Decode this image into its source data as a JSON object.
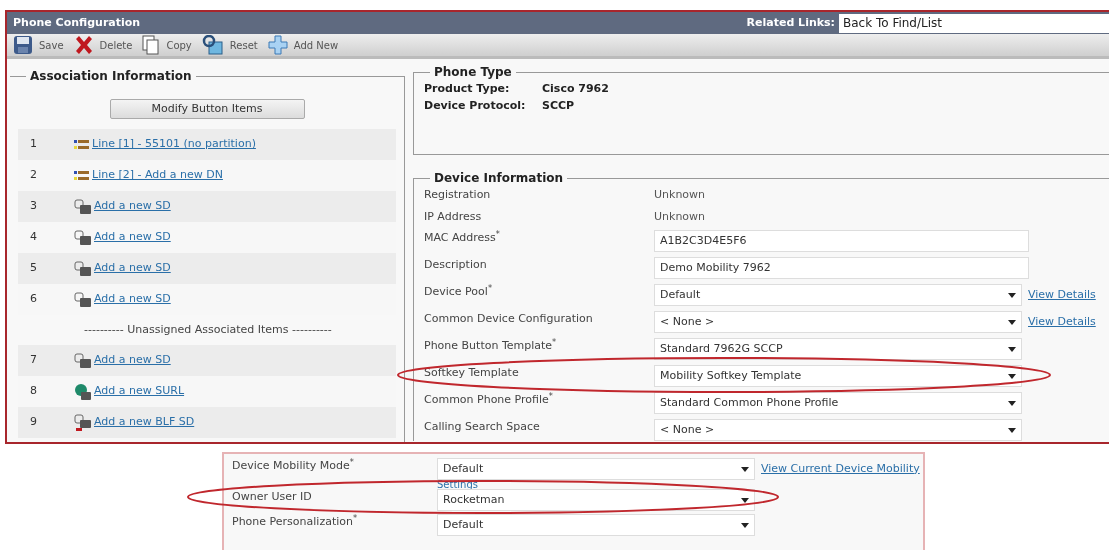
{
  "header": {
    "title": "Phone Configuration",
    "related_links_label": "Related Links:",
    "related_links_value": "Back To Find/List"
  },
  "toolbar": [
    {
      "kind": "save",
      "label": "Save"
    },
    {
      "kind": "delete",
      "label": "Delete"
    },
    {
      "kind": "copy",
      "label": "Copy"
    },
    {
      "kind": "reset",
      "label": "Reset"
    },
    {
      "kind": "add",
      "label": "Add New"
    }
  ],
  "association": {
    "legend": "Association Information",
    "modify_button": "Modify Button Items",
    "items": [
      {
        "number": "1",
        "kind": "line",
        "text": "Line [1] - 55101 (no partition)"
      },
      {
        "number": "2",
        "kind": "line",
        "text": "Line [2] - Add a new DN"
      },
      {
        "number": "3",
        "kind": "sd",
        "text": "Add a new SD"
      },
      {
        "number": "4",
        "kind": "sd",
        "text": "Add a new SD"
      },
      {
        "number": "5",
        "kind": "sd",
        "text": "Add a new SD"
      },
      {
        "number": "6",
        "kind": "sd",
        "text": "Add a new SD"
      }
    ],
    "separator": "---------- Unassigned Associated Items ----------",
    "unassigned_items": [
      {
        "number": "7",
        "kind": "sd",
        "text": "Add a new SD"
      },
      {
        "number": "8",
        "kind": "surl",
        "text": "Add a new SURL"
      },
      {
        "number": "9",
        "kind": "blf",
        "text": "Add a new BLF SD"
      }
    ]
  },
  "phone_type": {
    "legend": "Phone Type",
    "fields": [
      {
        "label": "Product Type:",
        "value": "Cisco 7962"
      },
      {
        "label": "Device Protocol:",
        "value": "SCCP"
      }
    ]
  },
  "device_information": {
    "legend": "Device Information",
    "fields": [
      {
        "kind": "text",
        "label": "Registration",
        "value": "Unknown"
      },
      {
        "kind": "text",
        "label": "IP Address",
        "value": "Unknown"
      },
      {
        "kind": "input",
        "label": "MAC Address$^{*}$",
        "value": "A1B2C3D4E5F6"
      },
      {
        "kind": "input",
        "label": "Description",
        "value": "Demo Mobility 7962"
      },
      {
        "kind": "select",
        "label": "Device Pool$^{*}$",
        "value": "Default",
        "link": "View Details"
      },
      {
        "kind": "select",
        "label": "Common Device Configuration",
        "value": "< None >",
        "link": "View Details"
      },
      {
        "kind": "select",
        "label": "Phone Button Template$^{*}$",
        "value": "Standard 7962G SCCP"
      },
      {
        "kind": "select",
        "label": "Softkey Template",
        "value": "Mobility Softkey Template"
      },
      {
        "kind": "select",
        "label": "Common Phone Profile$^{*}$",
        "value": "Standard Common Phone Profile"
      },
      {
        "kind": "select",
        "label": "Calling Search Space",
        "value": "< None >"
      }
    ]
  },
  "inset": {
    "fields": [
      {
        "kind": "select",
        "label": "Device Mobility Mode$^{*}$",
        "value": "Default",
        "link": "View Current Device Mobility",
        "link_continuation": "Settings"
      },
      {
        "kind": "select",
        "label": "Owner User ID",
        "value": "Rocketman"
      },
      {
        "kind": "select",
        "label": "Phone Personalization$^{*}$",
        "value": "Default"
      }
    ]
  }
}
